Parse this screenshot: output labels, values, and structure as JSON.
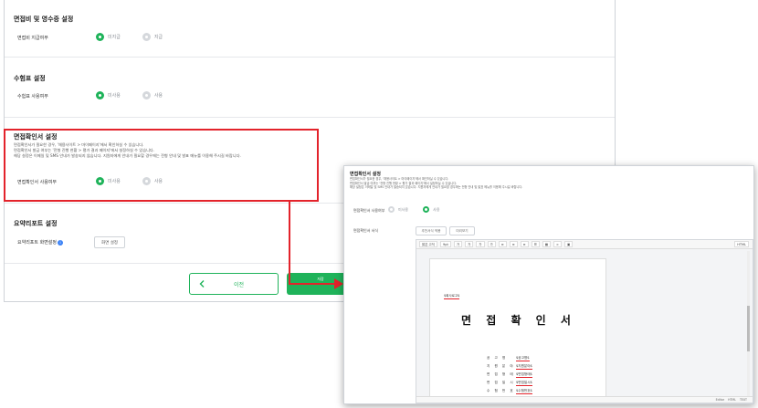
{
  "fee_section": {
    "title": "면접비 및 영수증 설정",
    "row_label": "면접비 지급여부",
    "options": [
      "미지급",
      "지급"
    ],
    "selected": 0
  },
  "ticket_section": {
    "title": "수험표 설정",
    "row_label": "수험표 사용여부",
    "options": [
      "미사용",
      "사용"
    ],
    "selected": 0
  },
  "confirm_section": {
    "title": "면접확인서 설정",
    "desc_lines": [
      "면접확인서가 필요한 경우, '채용사이트 > 마이페이지'에서 확인하실 수 있습니다.",
      "면접확인서 발급 여부는 '전형 진행 현황 > 평가 결과 페이지'에서 설정하실 수 있습니다.",
      "해당 설정은 이메일 및 SMS 안내가 발송되지 않습니다. 지원자에게 안내가 필요할 경우에는 전형 안내 및 발표 메뉴를 이용해 주시길 바랍니다."
    ],
    "row_label": "면접확인서 사용여부",
    "options": [
      "미사용",
      "사용"
    ],
    "selected": 0
  },
  "report_section": {
    "title": "요약리포트 설정",
    "row_label": "요약리포트 화면설정",
    "info_icon": "i",
    "button_label": "화면 설정"
  },
  "nav": {
    "prev_label": "이전",
    "prev_icon": "chevron-left-icon",
    "next_label": "저장"
  },
  "colors": {
    "accent": "#1fb35a",
    "highlight": "#e3232b"
  },
  "zoom": {
    "title": "면접확인서 설정",
    "desc_lines": [
      "면접확인서가 필요한 경우, '채용사이트 > 마이페이지'에서 확인하실 수 있습니다.",
      "면접확인서 발급 여부는 '전형 진행 현황 > 평가 결과 페이지'에서 설정하실 수 있습니다.",
      "해당 설정은 이메일 및 SMS 안내가 발송되지 않습니다. 지원자에게 안내가 필요할 경우에는 전형 안내 및 발표 메뉴를 이용해 주시길 바랍니다."
    ],
    "use_label": "면접확인서 사용여부",
    "options": [
      "미사용",
      "사용"
    ],
    "selected": 1,
    "form_label": "면접확인서 서식",
    "btn_insert": "추천서식 적용",
    "btn_preview": "미리보기",
    "toolbar_font": "맑은 고딕",
    "toolbar_size": "9pt",
    "toolbar_source": "HTML",
    "doc_logo": "$회사로고$",
    "doc_title": "면 접 확 인 서",
    "doc_fields": [
      {
        "k": "공 고 명",
        "v": "$공고명$"
      },
      {
        "k": "지 원 분 야",
        "v": "$지원분야$"
      },
      {
        "k": "면 접 형 태",
        "v": "$면접형태$"
      },
      {
        "k": "면 접 일 시",
        "v": "$면접일시$"
      },
      {
        "k": "수 험 번 호",
        "v": "$수험번호$"
      }
    ],
    "status": [
      "Editor",
      "HTML",
      "TEXT"
    ]
  }
}
